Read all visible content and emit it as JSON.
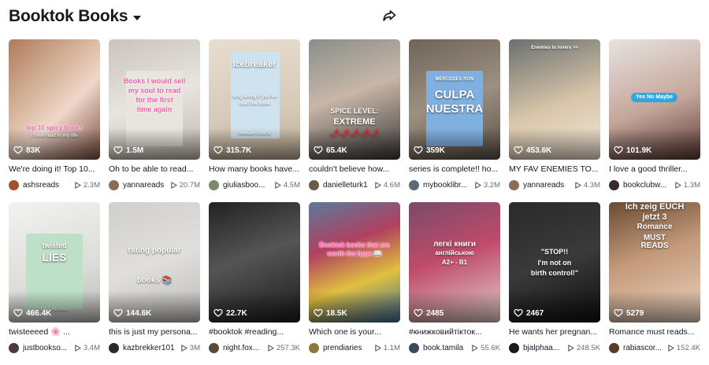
{
  "header": {
    "title": "Booktok Books"
  },
  "icons": {
    "caret": "chevron-down-icon",
    "share": "share-icon",
    "heart": "heart-icon",
    "play": "play-icon"
  },
  "colors": {
    "text": "#161823",
    "muted": "#6b6b73",
    "overlay_pink": "#ff5aa8",
    "pill_blue": "#2ea7e0"
  },
  "videos": [
    {
      "likes": "83K",
      "desc": "We're doing it! Top 10...",
      "user": "ashsreads",
      "views": "2.3M",
      "avatar": "#a0522d",
      "overlay": [
        "top 10 spicy books",
        "i have read in my life"
      ]
    },
    {
      "likes": "1.5M",
      "desc": "Oh to be able to read...",
      "user": "yannareads",
      "views": "20.7M",
      "avatar": "#8b6b5a",
      "overlay": [
        "Books I would sell",
        "my soul to read",
        "for the first",
        "time again"
      ]
    },
    {
      "likes": "315.7K",
      "desc": "How many books have...",
      "user": "giuliasboo...",
      "views": "4.5M",
      "avatar": "#7a8a6a",
      "overlay": [
        "Icebreaker",
        "Sing along if you've",
        "read the book",
        "HANNAH GRACE"
      ]
    },
    {
      "likes": "65.4K",
      "desc": "couldn't believe how...",
      "user": "danielleturk1",
      "views": "4.6M",
      "avatar": "#6a5a4a",
      "overlay": [
        "SPICE LEVEL:",
        "EXTREME",
        "🌶🌶🌶🌶🌶"
      ]
    },
    {
      "likes": "359K",
      "desc": "series is complete!! ho...",
      "user": "mybooklibr...",
      "views": "3.2M",
      "avatar": "#5a6a7a",
      "overlay": [
        "MERCEDES RON",
        "CULPA",
        "NUESTRA"
      ]
    },
    {
      "likes": "453.6K",
      "desc": "MY FAV ENEMIES TO...",
      "user": "yannareads",
      "views": "4.3M",
      "avatar": "#8b6b5a",
      "overlay": [
        "Enemies to lovers >>"
      ]
    },
    {
      "likes": "101.9K",
      "desc": "I love a good thriller...",
      "user": "bookclubw...",
      "views": "1.3M",
      "avatar": "#3a2a2a",
      "overlay": [
        "Yes No Maybe"
      ]
    },
    {
      "likes": "466.4K",
      "desc": "twisteeeed 🌸 ...",
      "user": "justbookso...",
      "views": "3.4M",
      "avatar": "#4a3a3a",
      "overlay": [
        "twisted",
        "LIES",
        "ANA HUANG"
      ]
    },
    {
      "likes": "144.6K",
      "desc": "this is just my persona...",
      "user": "kazbrekker101",
      "views": "3M",
      "avatar": "#2a2a2a",
      "overlay": [
        "rating popular",
        "books 📚"
      ]
    },
    {
      "likes": "22.7K",
      "desc": "#booktok #reading...",
      "user": "night.fox...",
      "views": "257.3K",
      "avatar": "#5a4a3a",
      "overlay": []
    },
    {
      "likes": "18.5K",
      "desc": "Which one is your...",
      "user": "prendiaries",
      "views": "1.1M",
      "avatar": "#8a7a3a",
      "overlay": [
        "Booktok books that are",
        "worth the hype 📖"
      ]
    },
    {
      "likes": "2485",
      "desc": "#книжковийтікток...",
      "user": "book.tamila",
      "views": "55.6K",
      "avatar": "#3a4a5a",
      "overlay": [
        "легкі книги",
        "англійською",
        "A2+ - B1"
      ]
    },
    {
      "likes": "2467",
      "desc": "He wants her pregnan...",
      "user": "bjalphaa...",
      "views": "248.5K",
      "avatar": "#1a1a1a",
      "overlay": [
        "\"STOP!!",
        "I'm not on",
        "birth control!\""
      ]
    },
    {
      "likes": "5279",
      "desc": "Romance must reads...",
      "user": "rabiascor...",
      "views": "152.4K",
      "avatar": "#5a3a2a",
      "overlay": [
        "Ich zeig EUCH",
        "jetzt 3",
        "Romance",
        "MUST",
        "READS"
      ]
    }
  ]
}
